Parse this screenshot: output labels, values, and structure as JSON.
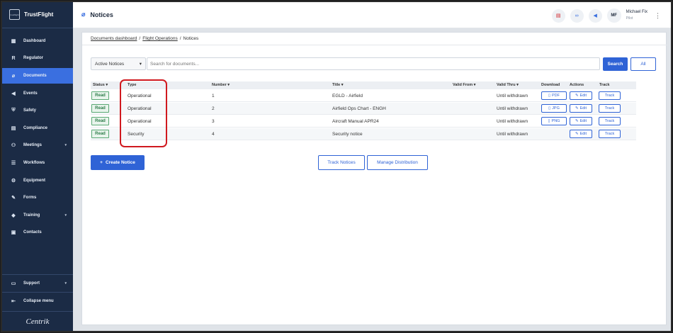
{
  "sidebar": {
    "brand": "TrustFlight",
    "logo_text": "trustflight",
    "items": [
      {
        "label": "Dashboard",
        "icon": "dashboard-icon",
        "glyph": "▦"
      },
      {
        "label": "Regulator",
        "icon": "regulator-icon",
        "glyph": "R"
      },
      {
        "label": "Documents",
        "icon": "paperclip-icon",
        "glyph": "⌀"
      },
      {
        "label": "Events",
        "icon": "megaphone-icon",
        "glyph": "◀"
      },
      {
        "label": "Safety",
        "icon": "shield-icon",
        "glyph": "⛨"
      },
      {
        "label": "Compliance",
        "icon": "clipboard-icon",
        "glyph": "▤"
      },
      {
        "label": "Meetings",
        "icon": "meetings-icon",
        "glyph": "⚇"
      },
      {
        "label": "Workflows",
        "icon": "workflow-icon",
        "glyph": "☰"
      },
      {
        "label": "Equipment",
        "icon": "equipment-icon",
        "glyph": "⚙"
      },
      {
        "label": "Forms",
        "icon": "forms-icon",
        "glyph": "✎"
      },
      {
        "label": "Training",
        "icon": "graduation-cap-icon",
        "glyph": "◆"
      },
      {
        "label": "Contacts",
        "icon": "contacts-icon",
        "glyph": "▣"
      }
    ],
    "support": "Support",
    "collapse": "Collapse menu",
    "footer_brand": "Centrik"
  },
  "topbar": {
    "title": "Notices",
    "user_initials": "MF",
    "user_name": "Michael Fix",
    "user_role": "Pilot"
  },
  "breadcrumb": {
    "items": [
      "Documents dashboard",
      "Flight Operations",
      "Notices"
    ]
  },
  "filter": {
    "selected": "Active Notices",
    "search_placeholder": "Search for documents...",
    "search_label": "Search",
    "all_label": "All"
  },
  "table": {
    "headers": {
      "status": "Status ▾",
      "type": "Type",
      "number": "Number ▾",
      "title": "Title ▾",
      "valid_from": "Valid From ▾",
      "valid_thru": "Valid Thru ▾",
      "download": "Download",
      "actions": "Actions",
      "track": "Track"
    },
    "rows": [
      {
        "status": "Read",
        "type": "Operational",
        "number": "1",
        "title": "EGLD - Airfield",
        "valid_thru": "Until withdrawn",
        "download": "PDF",
        "edit": "Edit",
        "track": "Track"
      },
      {
        "status": "Read",
        "type": "Operational",
        "number": "2",
        "title": "Airfield Ops Chart - ENGH",
        "valid_thru": "Until withdrawn",
        "download": "JPG",
        "edit": "Edit",
        "track": "Track"
      },
      {
        "status": "Read",
        "type": "Operational",
        "number": "3",
        "title": "Aircraft Manual APR24",
        "valid_thru": "Until withdrawn",
        "download": "PNG",
        "edit": "Edit",
        "track": "Track"
      },
      {
        "status": "Read",
        "type": "Security",
        "number": "4",
        "title": "Security notice",
        "valid_thru": "Until withdrawn",
        "download": "",
        "edit": "Edit",
        "track": "Track"
      }
    ]
  },
  "buttons": {
    "create": "Create Notice",
    "track_notices": "Track Notices",
    "manage_distribution": "Manage Distribution"
  },
  "colors": {
    "sidebar_bg": "#1b2b45",
    "accent": "#2f63d6",
    "highlight": "#d0191f",
    "status_read": "#2e7d4a"
  }
}
